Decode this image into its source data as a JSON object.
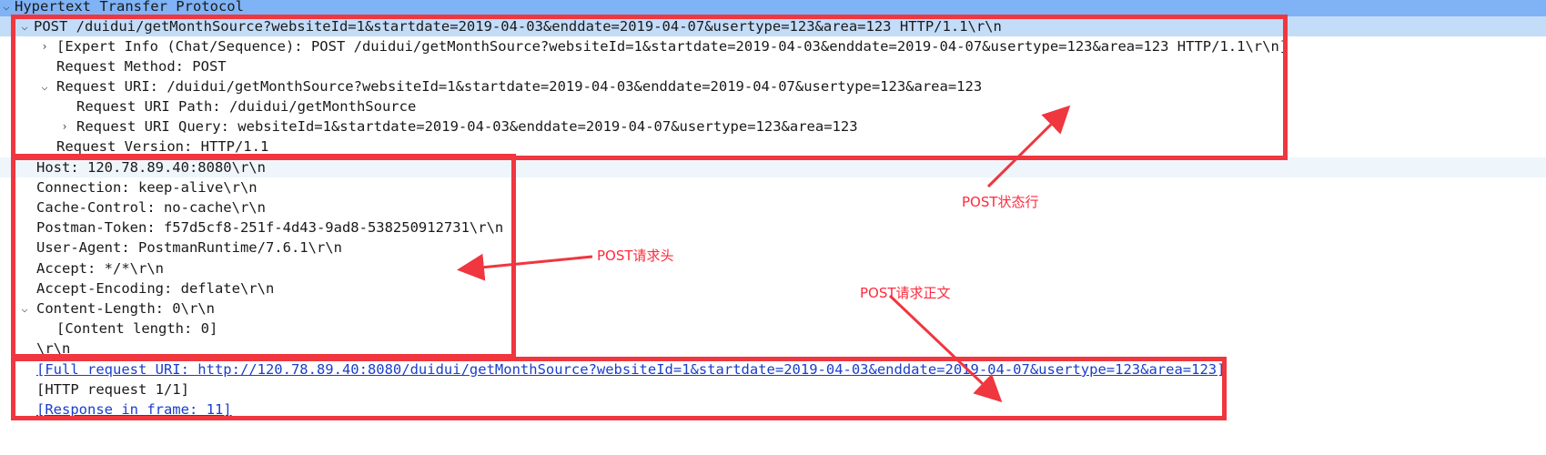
{
  "tree": {
    "header": "Hypertext Transfer Protocol",
    "request_line": "POST /duidui/getMonthSource?websiteId=1&startdate=2019-04-03&enddate=2019-04-07&usertype=123&area=123 HTTP/1.1\\r\\n",
    "expert_info": "[Expert Info (Chat/Sequence): POST /duidui/getMonthSource?websiteId=1&startdate=2019-04-03&enddate=2019-04-07&usertype=123&area=123 HTTP/1.1\\r\\n]",
    "request_method": "Request Method: POST",
    "request_uri": "Request URI: /duidui/getMonthSource?websiteId=1&startdate=2019-04-03&enddate=2019-04-07&usertype=123&area=123",
    "request_uri_path": "Request URI Path: /duidui/getMonthSource",
    "request_uri_query": "Request URI Query: websiteId=1&startdate=2019-04-03&enddate=2019-04-07&usertype=123&area=123",
    "request_version": "Request Version: HTTP/1.1",
    "host": "Host: 120.78.89.40:8080\\r\\n",
    "connection": "Connection: keep-alive\\r\\n",
    "cache_control": "Cache-Control: no-cache\\r\\n",
    "postman_token": "Postman-Token: f57d5cf8-251f-4d43-9ad8-538250912731\\r\\n",
    "user_agent": "User-Agent: PostmanRuntime/7.6.1\\r\\n",
    "accept": "Accept: */*\\r\\n",
    "accept_encoding": "Accept-Encoding: deflate\\r\\n",
    "content_length": "Content-Length: 0\\r\\n",
    "content_length_sub": "[Content length: 0]",
    "crlf": "\\r\\n",
    "full_request_uri": "[Full request URI: http://120.78.89.40:8080/duidui/getMonthSource?websiteId=1&startdate=2019-04-03&enddate=2019-04-07&usertype=123&area=123]",
    "http_request": "[HTTP request 1/1]",
    "response_in_frame": "[Response in frame: 11]"
  },
  "annotations": {
    "status_line": "POST状态行",
    "request_headers": "POST请求头",
    "request_body": "POST请求正文"
  },
  "colors": {
    "annotation_red": "#f0363f",
    "header_blue": "#7fb3f5",
    "selected_blue": "#c3dcf8",
    "link_blue": "#1a3ecc"
  }
}
